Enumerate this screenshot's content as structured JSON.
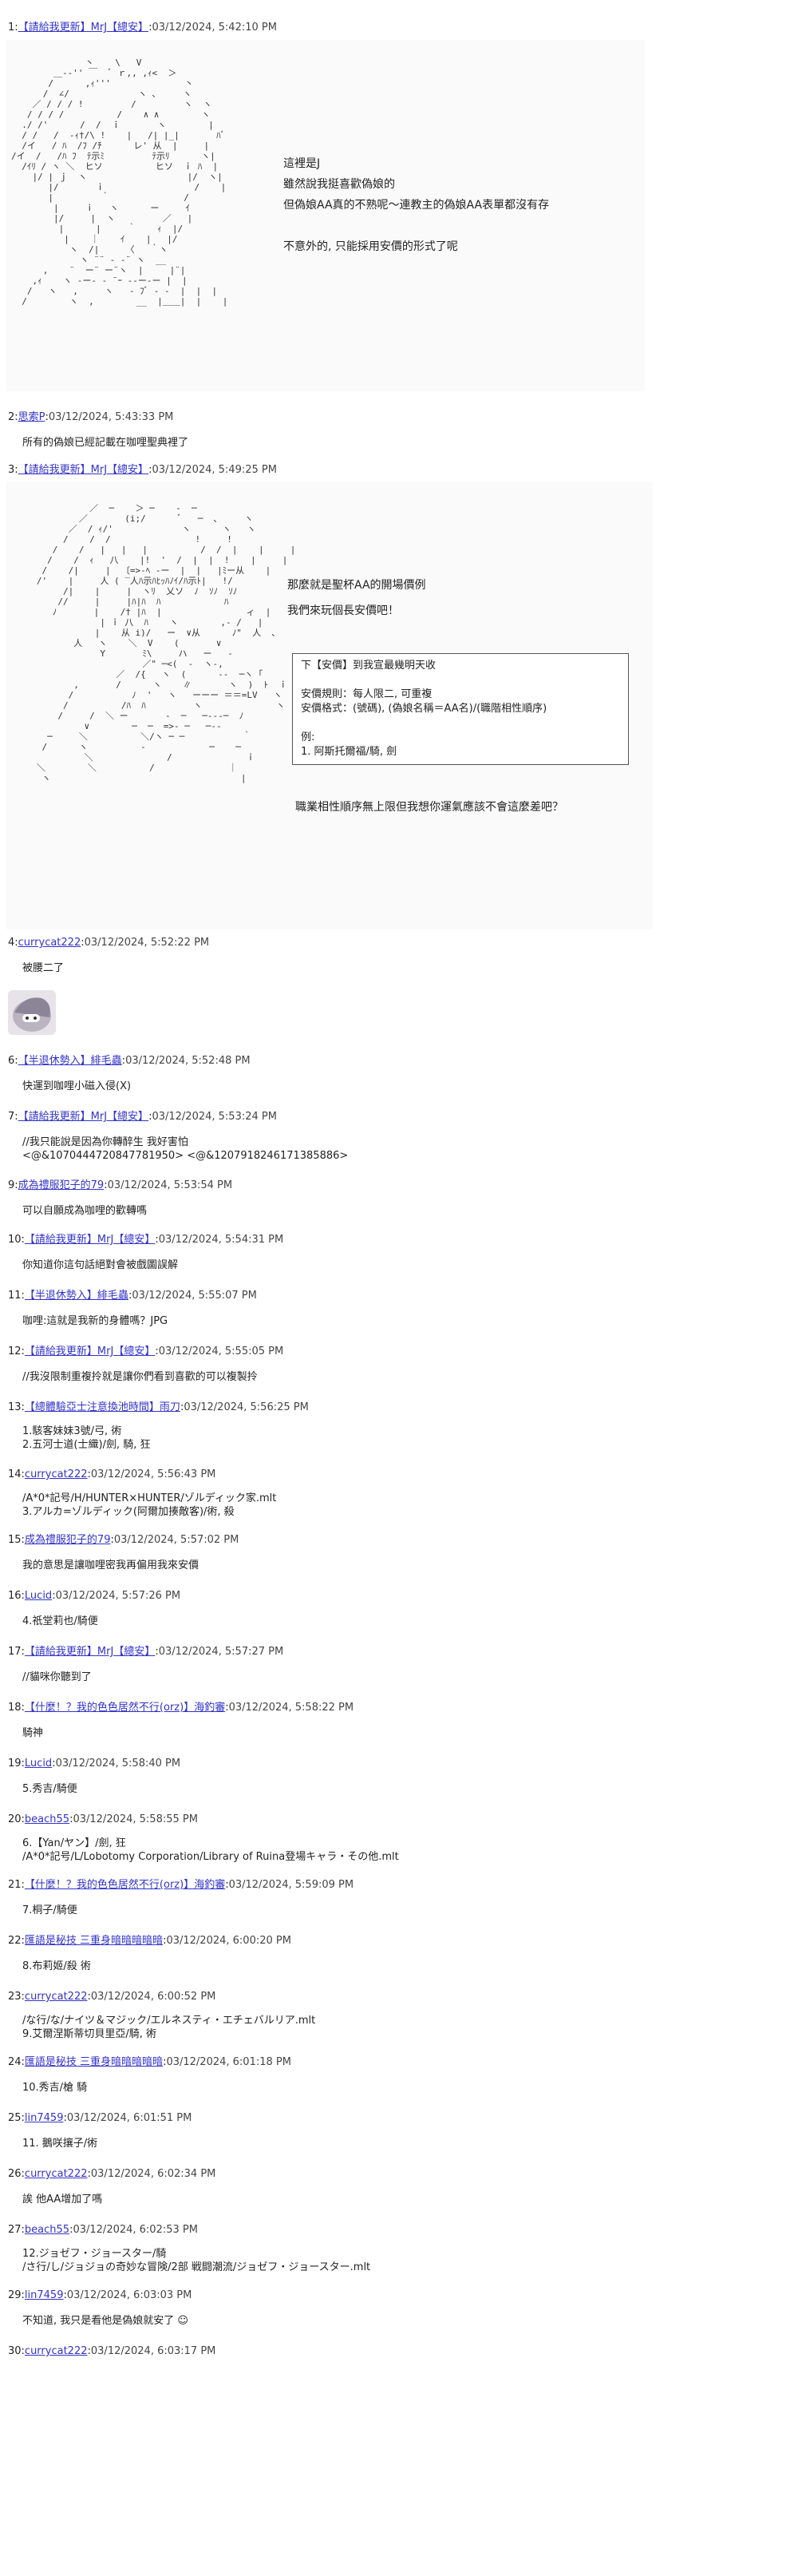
{
  "posts": [
    {
      "num": "1:",
      "name": "【請給我更新】MrJ【總安】",
      "date": "03/12/2024, 5:42:10 PM",
      "body": ""
    },
    {
      "num": "2:",
      "name": "思索P",
      "date": "03/12/2024, 5:43:33 PM",
      "body": "所有的偽娘已經記載在咖哩聖典裡了"
    },
    {
      "num": "3:",
      "name": "【請給我更新】MrJ【總安】",
      "date": "03/12/2024, 5:49:25 PM",
      "body": ""
    },
    {
      "num": "4:",
      "name": "currycat222",
      "date": "03/12/2024, 5:52:22 PM",
      "body": "被腰二了"
    },
    {
      "num": "6:",
      "name": "【半退休勢入】緋毛蟲",
      "date": "03/12/2024, 5:52:48 PM",
      "body": "快運到咖哩小磁入侵(X)"
    },
    {
      "num": "7:",
      "name": "【請給我更新】MrJ【總安】",
      "date": "03/12/2024, 5:53:24 PM",
      "body": "//我只能說是因為你轉醉生 我好害怕\n<@&1070444720847781950> <@&1207918246171385886>"
    },
    {
      "num": "9:",
      "name": "成為禮服犯子的79",
      "date": "03/12/2024, 5:53:54 PM",
      "body": "可以自願成為咖哩的歡轉嗎"
    },
    {
      "num": "10:",
      "name": "【請給我更新】MrJ【總安】",
      "date": "03/12/2024, 5:54:31 PM",
      "body": "你知道你這句話絕對會被戲圖誤解"
    },
    {
      "num": "11:",
      "name": "【半退休勢入】緋毛蟲",
      "date": "03/12/2024, 5:55:07 PM",
      "body": "咖哩:這就是我新的身體嗎？JPG"
    },
    {
      "num": "12:",
      "name": "【請給我更新】MrJ【總安】",
      "date": "03/12/2024, 5:55:05 PM",
      "body": "//我沒限制重複拎就是讓你們看到喜歡的可以複製拎"
    },
    {
      "num": "13:",
      "name": "【總體驗亞士注意換池時間】雨刀",
      "date": "03/12/2024, 5:56:25 PM",
      "body": "1.駭客妹妹3號/弓, 術\n2.五河士道(士織)/劍, 騎, 狂"
    },
    {
      "num": "14:",
      "name": "currycat222",
      "date": "03/12/2024, 5:56:43 PM",
      "body": "/A*0*記号/H/HUNTER×HUNTER/ゾルディック家.mlt\n3.アルカ=ゾルディック(阿爾加揍敵客)/術, 殺"
    },
    {
      "num": "15:",
      "name": "成為禮服犯子的79",
      "date": "03/12/2024, 5:57:02 PM",
      "body": "我的意思是讓咖哩密我再偏用我來安價"
    },
    {
      "num": "16:",
      "name": "Lucid",
      "date": "03/12/2024, 5:57:26 PM",
      "body": "4.祇堂莉也/騎便"
    },
    {
      "num": "17:",
      "name": "【請給我更新】MrJ【總安】",
      "date": "03/12/2024, 5:57:27 PM",
      "body": "//貓咪你聽到了"
    },
    {
      "num": "18:",
      "name": "【什麼！？我的色色居然不行(orz)】海釣審",
      "date": "03/12/2024, 5:58:22 PM",
      "body": "騎神"
    },
    {
      "num": "19:",
      "name": "Lucid",
      "date": "03/12/2024, 5:58:40 PM",
      "body": "5.秀吉/騎便"
    },
    {
      "num": "20:",
      "name": "beach55",
      "date": "03/12/2024, 5:58:55 PM",
      "body": "6.【Yan/ヤン】/劍, 狂\n/A*0*記号/L/Lobotomy Corporation/Library of Ruina登場キャラ・その他.mlt"
    },
    {
      "num": "21:",
      "name": "【什麼！？我的色色居然不行(orz)】海釣審",
      "date": "03/12/2024, 5:59:09 PM",
      "body": "7.桐子/騎便"
    },
    {
      "num": "22:",
      "name": "匯語是秘技 三重身暗暗暗暗暗",
      "date": "03/12/2024, 6:00:20 PM",
      "body": "8.布莉姬/殺 術"
    },
    {
      "num": "23:",
      "name": "currycat222",
      "date": "03/12/2024, 6:00:52 PM",
      "body": "/な行/な/ナイツ＆マジック/エルネスティ・エチェバルリア.mlt\n9.艾爾涅斯蒂切貝里亞/騎, 術"
    },
    {
      "num": "24:",
      "name": "匯語是秘技 三重身暗暗暗暗暗",
      "date": "03/12/2024, 6:01:18 PM",
      "body": "10.秀吉/槍 騎"
    },
    {
      "num": "25:",
      "name": "lin7459",
      "date": "03/12/2024, 6:01:51 PM",
      "body": "11. 鵝咲攘子/術"
    },
    {
      "num": "26:",
      "name": "currycat222",
      "date": "03/12/2024, 6:02:34 PM",
      "body": "誒 他AA增加了嗎"
    },
    {
      "num": "27:",
      "name": "beach55",
      "date": "03/12/2024, 6:02:53 PM",
      "body": "12.ジョゼフ・ジョースター/騎\n/さ行/し/ジョジョの奇妙な冒険/2部 戦闘潮流/ジョゼフ・ジョースター.mlt"
    },
    {
      "num": "29:",
      "name": "lin7459",
      "date": "03/12/2024, 6:03:03 PM",
      "body": "不知道, 我只是看他是偽娘就安了 ☺"
    },
    {
      "num": "30:",
      "name": "currycat222",
      "date": "03/12/2024, 6:03:17 PM",
      "body": ""
    }
  ],
  "post1": {
    "lines": [
      "這裡是J",
      "雖然說我挺喜歡偽娘的",
      "但偽娘AA真的不熟呢～連教主的偽娘AA表單都沒有存",
      "",
      "不意外的, 只能採用安價的形式了呢"
    ]
  },
  "post3": {
    "line1": "那麼就是聖杯AA的開場價例",
    "line2": "我們來玩個長安價吧！",
    "panel": "下【安價】到我宣最幾明天收\n\n安價規則：每人限二, 可重複\n安價格式：(號碼), (偽娘名稱＝AA名)/(職階相性順序)\n\n例:\n1. 阿斯托爾福/騎, 劍",
    "line3": "職業相性順序無上限但我想你運氣應該不會這麼差吧？"
  },
  "aa1": "              丶    \\   V\n        ＿-‐'' ￣  ﾞ ｒ,, ,ｨ<  ＞\n       /      ,ｨ'''              丶\n      /  ∠/             ヽ ､     ヽ\n    ／ / / / !         /         ヽ  ヽ\n   / / / /          /    ∧ ∧        ヽ\n  ./ /'      /  /  ｉ       ヽ        |\n  / /   /  -ｨ†/\\ !    |   /| |_|       ﾊﾞ\n  /イ   / ﾊ  /ﾌ /ﾁ      レ' 从  |     |\n/イ  /   /ﾊ ﾌ  ﾃ示ﾐ         ﾃ示ﾘ      ヽ|\n  /ｲﾘ / ヽ ＼  ヒソ          ヒソ  ｉ ﾊ  |\n    |/ | ｊ  ヽ                   |/  ヽ|\n       |/       ｉ                 /    |\n       |         ｀              /\n        |     ｉ   ヽ      ー     ｲ\n        |/     |  ヽ         ／   |\n         |      |     ｀    ｨ  |/\n          |    ｜    ｲ    |   |/\n           ヽ  /|     〈   ｀ヽ\n             ヽ ¨¨ ‐ ‐¨ ヽ  __\n      ,    ¨  ー¨ ー¨ヽ  |     |¨|\n    ,ｨ    ヽ ‐ー‐ ‐ ¨ｰ ‐‐ー‐ー |  |\n   /   ヽ   ,     ヽ   ‐ ﾌﾞ ‐ ‐  |  |  |\n  /        ヽ  ,        __  |＿＿|  |    |",
  "aa3": "             ／  ─    ＞ ─    ‐  ─\n           ／       (i;/      ﾞ   ─  ､     ヽ\n         ／  / ｨ/'             ヽ      ヽ   ヽ\n        /    /  /                !     !\n      /    /   |   |   |          /  /  |    |     |\n     /    /  ｨ   八    |!  '  /  |  |  !    |     |\n    /    /|     |  〔=>-ﾍ ‐ー  |  |   |ﾐー从    |\n   /'    |     人 ( ‾人ﾊ示ﾊﾋｯﾊﾉｲ/ﾊ示ﾄ|   !/\n        /|    |     |  ヽﾘ  乂ソ  ﾉ  ｿﾉ  ｿﾉ\n       //     |     |ﾊ|ﾊ  ﾊ            ﾊ\n      ﾉ       |    /† |ﾊ  |                ィ  |\n               | ｉ 八  ﾊ    ヽ        ,‐ /   |\n              |    从 i)/   ー  ∨从      ﾉ\"  人  ､\n          人   ヽ    ＼  V    (       ∨\n               Y       ﾐ\\     ハ   ー   ‐\n                       ／\" ─<(  ‐  ヽ-,\n                  ／  /{   ヽ  (      ‐‐  ─ヽ ｢\n          ,       /      ヽ    ∥       ヽ  )  ﾄ  ｉ\n         /           ﾉ  '   ヽ   ーーー ＝＝=LV   ヽ\n        /          /ﾊ  ﾊ         ヽ              ヽ\n       /     /  ＼ ー       ‐  ─   ─‐‐‐─  ﾉ\n            ∨        ─  ─  =>‐ ─   ─‐‐\n     ─     ＼          ＼/ヽ ─ ─           ｀\n    /      ヽ          ‐            ─    ─\n            ＼              /              ｉ\n   ＼        ＼          /              ｜\n    ヽ                                    |"
}
